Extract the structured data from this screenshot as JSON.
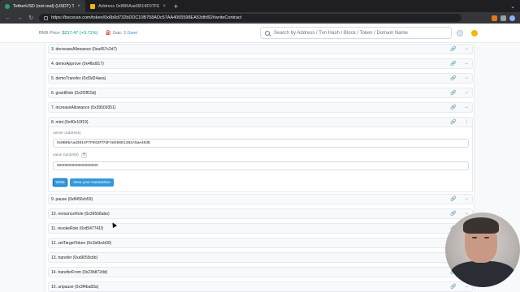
{
  "browser": {
    "tabs": [
      {
        "title": "TetherUSD (not-real) (USDT) To",
        "active": true
      },
      {
        "title": "Address 0x8B6Aad3814F07FE62F",
        "active": false
      }
    ],
    "new_tab": "+",
    "url": "https://bscscan.com/token/0x6b0d732bDDC10B758ADc57AA4065598EA53dfd92#writeContract"
  },
  "header": {
    "bnb_label": "BNB Price:",
    "bnb_price": "$217.47 (+0.71%)",
    "gas_label": "Gas:",
    "gas_value": "3 Gwei",
    "search_placeholder": "Search by Address / Txn Hash / Block / Token / Domain Name"
  },
  "functions": [
    {
      "label": "3. decreaseAllowance (0xa457c2d7)"
    },
    {
      "label": "4. demoApprove (0x4fbd917)"
    },
    {
      "label": "5. demoTransfer (0xf3d24aea)"
    },
    {
      "label": "6. grantRole (0x2f2ff15d)"
    },
    {
      "label": "7. increaseAllowance (0x39509351)"
    },
    {
      "label": "8. mint (0x40c10f19)"
    },
    {
      "label": "9. pause (0x8456cb59)"
    },
    {
      "label": "10. renounceRole (0x36568abe)"
    },
    {
      "label": "11. revokeRole (0xd547741f)"
    },
    {
      "label": "12. setTargetToken (0x1b6bcb00)"
    },
    {
      "label": "13. transfer (0xa9059cbb)"
    },
    {
      "label": "14. transferFrom (0x23b872dd)"
    },
    {
      "label": "15. unpause (0x3f4ba83a)"
    }
  ],
  "mint": {
    "owner_label": "owner (address)",
    "owner_value": "0x8B6bAad3814F7FE62Ff7dF4eE66E1382A5ae463E",
    "value_label": "value (uint256)",
    "plus": "+",
    "value_value": "9000000000000000000",
    "write_label": "Write",
    "view_label": "View your transaction"
  },
  "icons": {
    "link": "🔗",
    "arrow_right": "→",
    "arrow_down": "↓"
  }
}
